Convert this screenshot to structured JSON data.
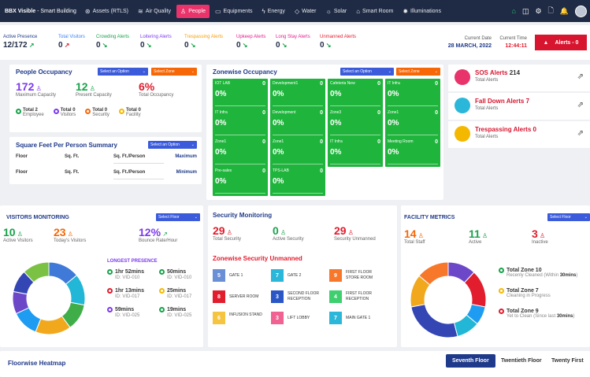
{
  "brand": {
    "name": "BBX Visible",
    "suffix": " - Smart Building"
  },
  "nav": [
    {
      "icon": "⊛",
      "label": "Assets (RTLS)",
      "active": false
    },
    {
      "icon": "≋",
      "label": "Air Quality",
      "active": false
    },
    {
      "icon": "♙",
      "label": "People",
      "active": true
    },
    {
      "icon": "▭",
      "label": "Equipments",
      "active": false
    },
    {
      "icon": "ϟ",
      "label": "Energy",
      "active": false
    },
    {
      "icon": "◇",
      "label": "Water",
      "active": false
    },
    {
      "icon": "☼",
      "label": "Solar",
      "active": false
    },
    {
      "icon": "⌂",
      "label": "Smart Room",
      "active": false
    },
    {
      "icon": "✹",
      "label": "Illuminations",
      "active": false
    }
  ],
  "stats": [
    {
      "label": "Active Presence",
      "value": "12/172",
      "color": "#1f3a8a",
      "trend": "up"
    },
    {
      "label": "Total Visitors",
      "value": "0",
      "color": "#3b82f6",
      "trend": "down"
    },
    {
      "label": "Crowding Alerts",
      "value": "0",
      "color": "#17a34a",
      "trend": "flat"
    },
    {
      "label": "Loitering Alerts",
      "value": "0",
      "color": "#7c3aed",
      "trend": "flat"
    },
    {
      "label": "Trespassing Alerts",
      "value": "0",
      "color": "#f59e0b",
      "trend": "flat"
    },
    {
      "label": "Upkeep Alerts",
      "value": "0",
      "color": "#e11d8e",
      "trend": "flat"
    },
    {
      "label": "Long Stay Alerts",
      "value": "0",
      "color": "#e11d8e",
      "trend": "flat"
    },
    {
      "label": "Unmanned Alerts",
      "value": "0",
      "color": "#e11d2e",
      "trend": "flat"
    }
  ],
  "date": {
    "label": "Current Date",
    "value": "28 MARCH, 2022"
  },
  "time": {
    "label": "Current Time",
    "value": "12:44:11"
  },
  "alerts_button": {
    "label": "Alerts - 0"
  },
  "people": {
    "title": "People Occupancy",
    "select1": "Select an Option",
    "select2": "Select Zone",
    "max": {
      "value": "172",
      "label": "Maximum Capacity"
    },
    "present": {
      "value": "12",
      "label": "Present Capacity"
    },
    "occupancy": {
      "value": "6%",
      "label": "Total Occupancy"
    },
    "tags": [
      {
        "title": "Total 2",
        "sub": "Employee",
        "color": "#17a34a"
      },
      {
        "title": "Total 0",
        "sub": "Visitors",
        "color": "#7c3aed"
      },
      {
        "title": "Total 0",
        "sub": "Security",
        "color": "#f76707"
      },
      {
        "title": "Total 0",
        "sub": "Facility",
        "color": "#f5b800"
      }
    ]
  },
  "sqft": {
    "title": "Square Feet Per Person Summary",
    "select": "Select an Option",
    "rows": [
      {
        "c1": "Floor",
        "c2": "Sq. Ft.",
        "c3": "Sq. Ft./Person",
        "c4": "Maximum"
      },
      {
        "c1": "Floor",
        "c2": "Sq. Ft.",
        "c3": "Sq. Ft./Person",
        "c4": "Minimum"
      }
    ]
  },
  "zonewise": {
    "title": "Zonewise Occupancy",
    "select1": "Select an Option",
    "select2": "Select Zone",
    "tiles": [
      {
        "name": "IOT LAB",
        "count": "0",
        "pct": "0%"
      },
      {
        "name": "Development1",
        "count": "0",
        "pct": "0%"
      },
      {
        "name": "Cafeteria New",
        "count": "0",
        "pct": "0%"
      },
      {
        "name": "IT Infra",
        "count": "0",
        "pct": "0%"
      },
      {
        "name": "IT Infra",
        "count": "0",
        "pct": "0%"
      },
      {
        "name": "Development",
        "count": "0",
        "pct": "0%"
      },
      {
        "name": "Zone3",
        "count": "0",
        "pct": "0%"
      },
      {
        "name": "Zone1",
        "count": "0",
        "pct": "0%"
      },
      {
        "name": "Zone1",
        "count": "0",
        "pct": "0%"
      },
      {
        "name": "Zone1",
        "count": "0",
        "pct": "0%"
      },
      {
        "name": "IT Infra",
        "count": "0",
        "pct": "0%"
      },
      {
        "name": "Meeting Room",
        "count": "0",
        "pct": "0%"
      },
      {
        "name": "Pre-sales",
        "count": "0",
        "pct": "0%"
      },
      {
        "name": "TPS-LAB",
        "count": "0",
        "pct": "0%"
      }
    ]
  },
  "alert_cards": [
    {
      "title": "SOS Alerts",
      "count": "214",
      "sub": "Total Alerts",
      "icon": "sos-icon"
    },
    {
      "title": "Fall Down Alerts",
      "count": "7",
      "sub": "Total Alerts",
      "icon": "fall-down-icon"
    },
    {
      "title": "Trespassing Alerts",
      "count": "0",
      "sub": "Total Alerts",
      "icon": "trespassing-icon"
    }
  ],
  "visitors": {
    "title": "VISITORS MONITORING",
    "select": "Select Floor",
    "active": {
      "value": "10",
      "label": "Active Visitors"
    },
    "today": {
      "value": "23",
      "label": "Today's Visitors"
    },
    "bounce": {
      "value": "12%",
      "label": "Bounce Rate/Hour"
    },
    "longest_title": "LONGEST PRESENCE",
    "longest": [
      {
        "time": "1hr 52mins",
        "id": "ID: VID-010",
        "color": "#17a34a"
      },
      {
        "time": "50mins",
        "id": "ID: VID-010",
        "color": "#17a34a"
      },
      {
        "time": "1hr 13mins",
        "id": "ID: VID-017",
        "color": "#e11d2e"
      },
      {
        "time": "25mins",
        "id": "ID: VID-017",
        "color": "#f5b800"
      },
      {
        "time": "59mins",
        "id": "ID: VID-025",
        "color": "#7c3aed"
      },
      {
        "time": "19mins",
        "id": "ID: VID-025",
        "color": "#17a34a"
      }
    ],
    "donut": [
      {
        "value": 14,
        "color": "#3f7ad8"
      },
      {
        "value": 14,
        "color": "#22b7d6"
      },
      {
        "value": 12,
        "color": "#3fae49"
      },
      {
        "value": 16,
        "color": "#f2a81d"
      },
      {
        "value": 12,
        "color": "#1e9cf2"
      },
      {
        "value": 10,
        "color": "#6c48c9"
      },
      {
        "value": 10,
        "color": "#3346b4"
      },
      {
        "value": 12,
        "color": "#7bc143"
      }
    ]
  },
  "security": {
    "title": "Security Monitoring",
    "total": {
      "value": "29",
      "label": "Total Security"
    },
    "active": {
      "value": "0",
      "label": "Active Security"
    },
    "unmanned": {
      "value": "29",
      "label": "Security Unmanned"
    },
    "zonewise_title": "Zonewise Security Unmanned",
    "chips": [
      {
        "n": "5",
        "label": "GATE 1",
        "color": "#6b8fd6"
      },
      {
        "n": "7",
        "label": "GATE 2",
        "color": "#2bb7d9"
      },
      {
        "n": "9",
        "label": "FIRST FLOOR STORE ROOM",
        "color": "#f7772b"
      },
      {
        "n": "8",
        "label": "SERVER ROOM",
        "color": "#e11d2e"
      },
      {
        "n": "3",
        "label": "SECOND FLOOR RECEPTION",
        "color": "#2a56c6"
      },
      {
        "n": "4",
        "label": "FIRST FLOOR RECEPTION",
        "color": "#3ecf6e"
      },
      {
        "n": "6",
        "label": "INFUSION STAND",
        "color": "#f5c542"
      },
      {
        "n": "3",
        "label": "LIFT LOBBY",
        "color": "#f06292"
      },
      {
        "n": "7",
        "label": "MAIN GATE 1",
        "color": "#2bb7d9"
      }
    ]
  },
  "facility": {
    "title": "FACILITY METRICS",
    "select": "Select Floor",
    "staff": {
      "value": "14",
      "label": "Total Staff"
    },
    "active": {
      "value": "11",
      "label": "Active"
    },
    "inactive": {
      "value": "3",
      "label": "Inactive"
    },
    "legend": [
      {
        "title": "Total Zone 10",
        "sub1": "Recenly Cleaned (Within ",
        "sub2": "30mins",
        "sub3": ")",
        "color": "#17a34a"
      },
      {
        "title": "Total Zone 7",
        "sub1": "Cleaning in Progress",
        "sub2": "",
        "sub3": "",
        "color": "#f5b800"
      },
      {
        "title": "Total Zone 9",
        "sub1": "Yet to Clean (Since last ",
        "sub2": "30mins",
        "sub3": ")",
        "color": "#e11d2e"
      }
    ],
    "donut": [
      {
        "value": 12,
        "color": "#6c48c9"
      },
      {
        "value": 16,
        "color": "#e11d2e"
      },
      {
        "value": 8,
        "color": "#1e9cf2"
      },
      {
        "value": 10,
        "color": "#22b7d6"
      },
      {
        "value": 26,
        "color": "#3346b4"
      },
      {
        "value": 14,
        "color": "#f2a81d"
      },
      {
        "value": 14,
        "color": "#f7772b"
      }
    ]
  },
  "heatmap": {
    "title": "Floorwise Heatmap",
    "tabs": [
      {
        "label": "Seventh Floor",
        "active": true
      },
      {
        "label": "Twentieth Floor",
        "active": false
      },
      {
        "label": "Twenty First",
        "active": false
      }
    ]
  }
}
